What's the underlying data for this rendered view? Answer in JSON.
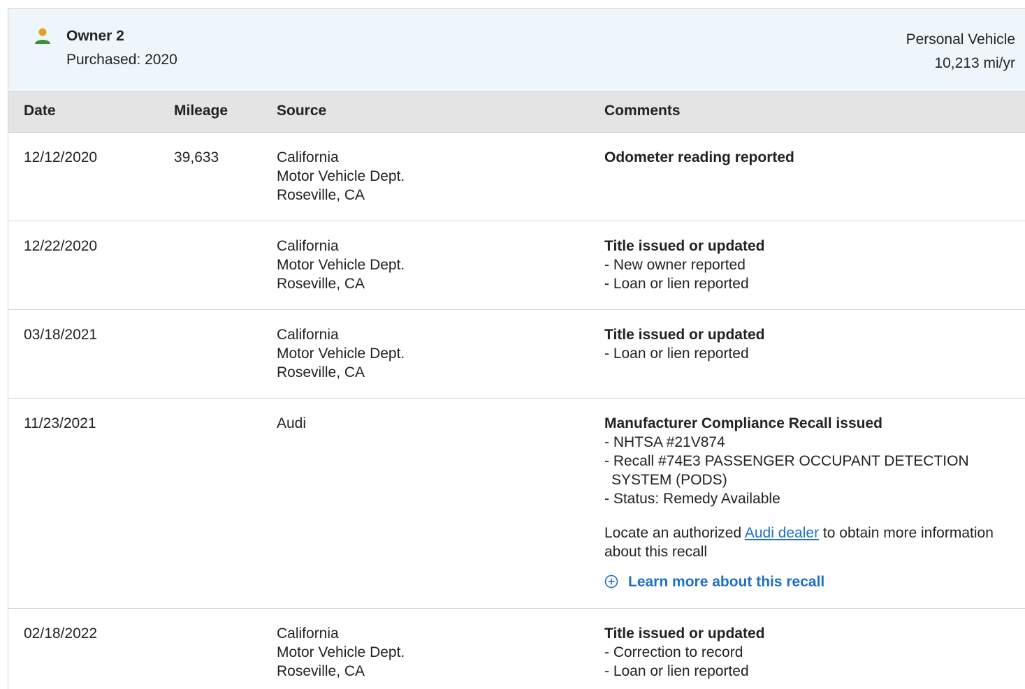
{
  "owner": {
    "name": "Owner 2",
    "purchased": "Purchased: 2020",
    "vehicle_type": "Personal Vehicle",
    "annual_mileage": "10,213 mi/yr",
    "icon": "person-icon",
    "icon_color": "#3a8f3a",
    "icon_head_color": "#e0a020"
  },
  "table": {
    "headers": {
      "date": "Date",
      "mileage": "Mileage",
      "source": "Source",
      "comments": "Comments"
    },
    "rows": [
      {
        "date": "12/12/2020",
        "mileage": "39,633",
        "source": [
          "California",
          "Motor Vehicle Dept.",
          "Roseville, CA"
        ],
        "title": "Odometer reading reported",
        "items": []
      },
      {
        "date": "12/22/2020",
        "mileage": "",
        "source": [
          "California",
          "Motor Vehicle Dept.",
          "Roseville, CA"
        ],
        "title": "Title issued or updated",
        "items": [
          "- New owner reported",
          "- Loan or lien reported"
        ]
      },
      {
        "date": "03/18/2021",
        "mileage": "",
        "source": [
          "California",
          "Motor Vehicle Dept.",
          "Roseville, CA"
        ],
        "title": "Title issued or updated",
        "items": [
          "- Loan or lien reported"
        ]
      },
      {
        "date": "11/23/2021",
        "mileage": "",
        "source": [
          "Audi"
        ],
        "title": "Manufacturer Compliance Recall issued",
        "items": [
          "- NHTSA #21V874",
          "- Recall #74E3 PASSENGER OCCUPANT DETECTION SYSTEM (PODS)",
          "- Status: Remedy Available"
        ],
        "recall": {
          "text_before": "Locate an authorized ",
          "link_text": "Audi dealer",
          "text_after": " to obtain more information about this recall",
          "learn_more": "Learn more about this recall",
          "learn_more_icon": "plus-circle-icon"
        }
      },
      {
        "date": "02/18/2022",
        "mileage": "",
        "source": [
          "California",
          "Motor Vehicle Dept.",
          "Roseville, CA"
        ],
        "title": "Title issued or updated",
        "items": [
          "- Correction to record",
          "- Loan or lien reported"
        ]
      }
    ]
  },
  "colors": {
    "header_bg": "#eef6fc",
    "table_head_bg": "#e4e4e4",
    "link": "#1f6fc5"
  }
}
